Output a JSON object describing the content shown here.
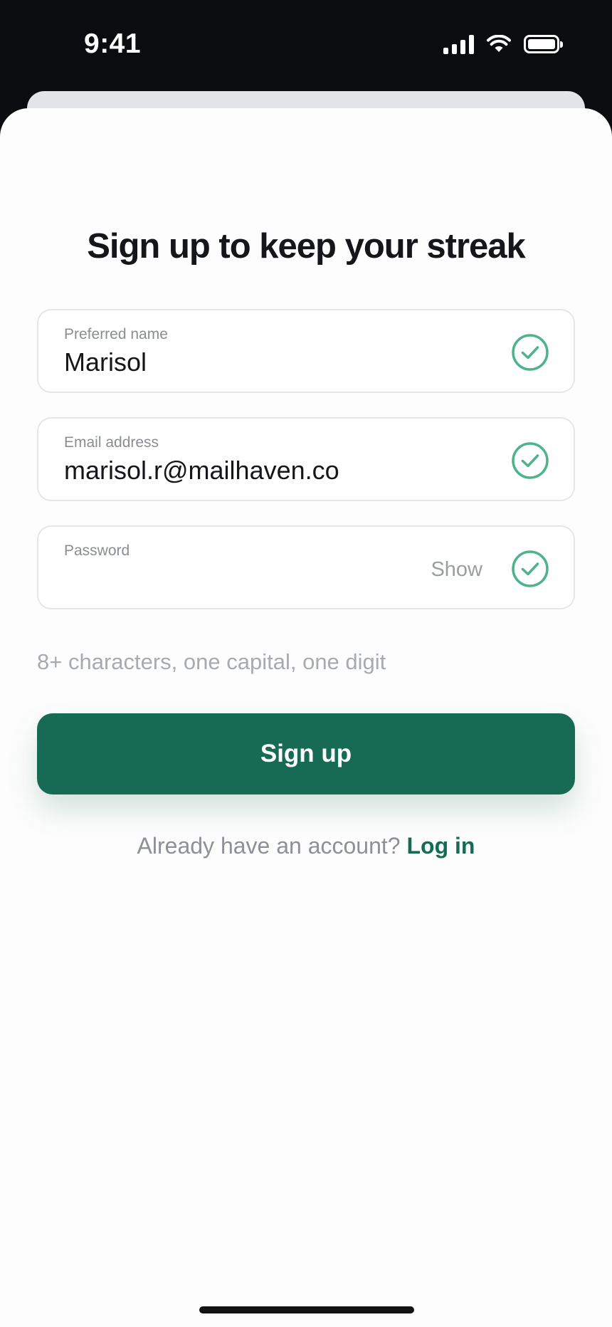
{
  "status_bar": {
    "time": "9:41"
  },
  "form": {
    "title": "Sign up to keep your streak",
    "fields": [
      {
        "label": "Preferred name",
        "value": "Marisol",
        "valid": true
      },
      {
        "label": "Email address",
        "value": "marisol.r@mailhaven.co",
        "valid": true
      },
      {
        "label": "Password",
        "value": "",
        "valid": true,
        "toggle_label": "Show"
      }
    ],
    "hint": "8+ characters, one capital, one digit",
    "submit_label": "Sign up",
    "login_prompt": "Already have an account?",
    "login_link": "Log in"
  },
  "colors": {
    "accent": "#176b54",
    "valid_check": "#4cb38b",
    "background": "#fdfdfd"
  },
  "icons": {
    "valid": "check-circle-icon",
    "signal": "cellular-signal-icon",
    "wifi": "wifi-icon",
    "battery": "battery-icon"
  }
}
